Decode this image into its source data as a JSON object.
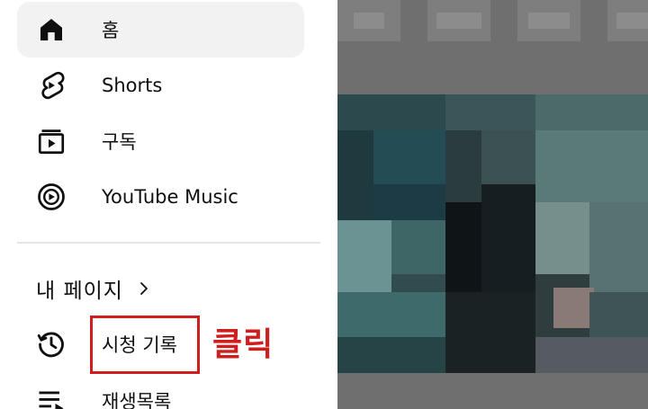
{
  "sidebar": {
    "items": [
      {
        "label": "홈",
        "icon": "home-icon",
        "active": true
      },
      {
        "label": "Shorts",
        "icon": "shorts-icon",
        "active": false
      },
      {
        "label": "구독",
        "icon": "subscriptions-icon",
        "active": false
      },
      {
        "label": "YouTube Music",
        "icon": "youtube-music-icon",
        "active": false
      }
    ],
    "my_page": {
      "title": "내 페이지",
      "icon": "chevron-right-icon"
    },
    "history": {
      "label": "시청 기록",
      "icon": "history-icon"
    },
    "playlists": {
      "label": "재생목록",
      "icon": "playlist-icon"
    }
  },
  "annotation": {
    "text": "클릭",
    "color": "#d01e1e"
  },
  "colors": {
    "active_bg": "#f2f2f2",
    "divider": "#e5e5e5",
    "highlight": "#d01e1e"
  }
}
